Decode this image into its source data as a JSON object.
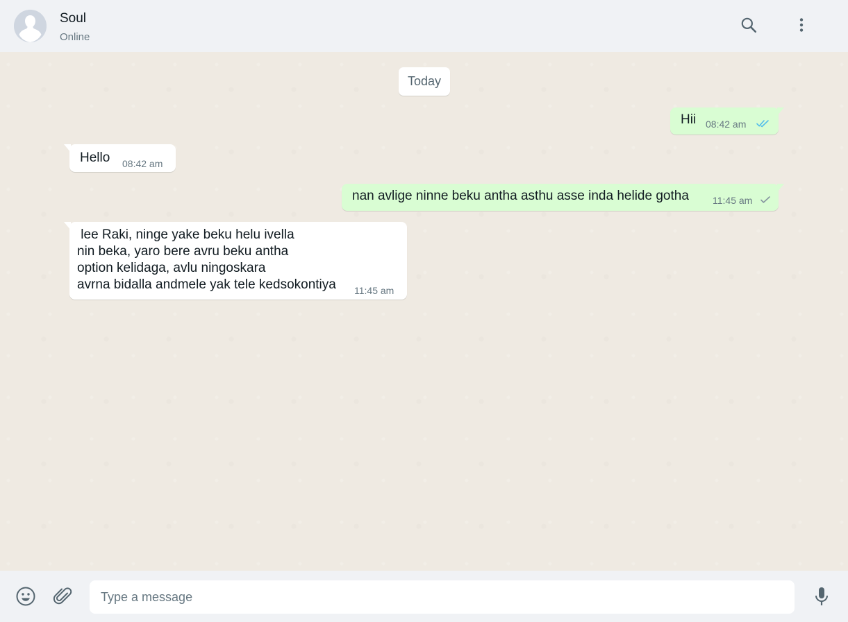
{
  "header": {
    "contact_name": "Soul",
    "status": "Online",
    "icons": [
      "avatar-icon",
      "search-icon",
      "menu-icon"
    ]
  },
  "chat": {
    "date_label": "Today",
    "messages": [
      {
        "direction": "outgoing",
        "text": "Hii",
        "time": "08:42 am",
        "status": "read"
      },
      {
        "direction": "incoming",
        "text": "Hello",
        "time": "08:42 am"
      },
      {
        "direction": "outgoing",
        "text": "nan avlige ninne beku antha asthu asse inda helide gotha",
        "time": "11:45 am",
        "status": "sent"
      },
      {
        "direction": "incoming",
        "text": " lee Raki, ninge yake beku helu ivella\nnin beka, yaro bere avru beku antha\noption kelidaga, avlu ningoskara\navrna bidalla andmele yak tele kedsokontiya",
        "time": "11:45 am"
      }
    ]
  },
  "composer": {
    "placeholder": "Type a message",
    "value": "",
    "icons": [
      "emoji-icon",
      "attach-icon",
      "mic-icon"
    ]
  },
  "colors": {
    "header_bg": "#f0f2f5",
    "chat_bg": "#efeae2",
    "outgoing_bubble": "#d9fdd3",
    "incoming_bubble": "#ffffff",
    "read_tick": "#53bdeb",
    "icon": "#54656f"
  }
}
